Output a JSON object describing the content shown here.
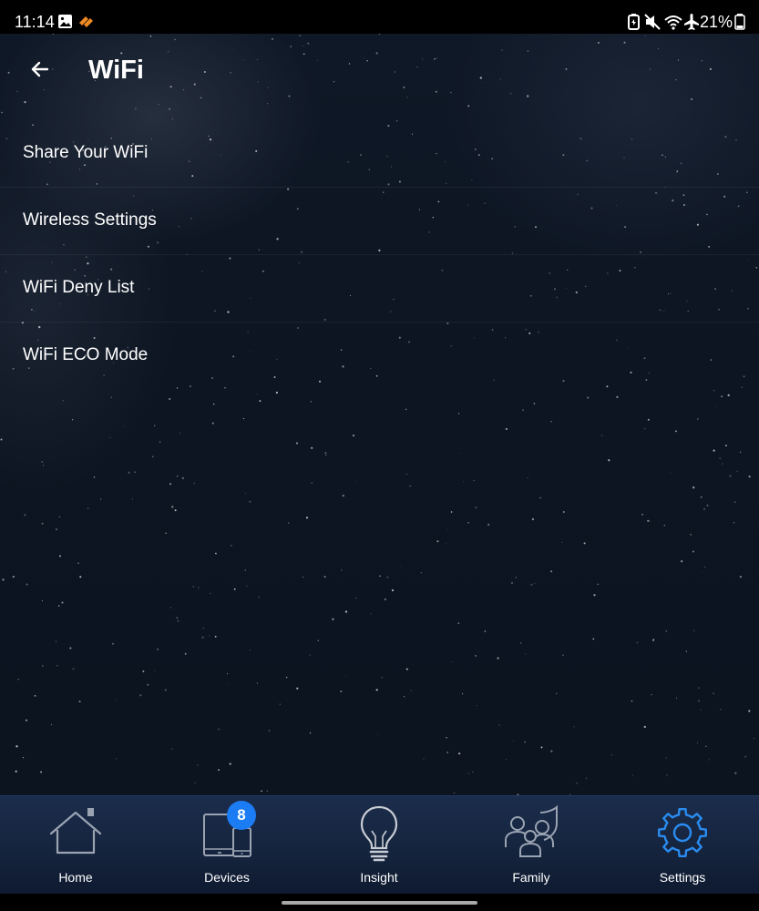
{
  "status_bar": {
    "time": "11:14",
    "battery_percent": "21%",
    "icons": [
      "gallery-icon",
      "app-notification-icon",
      "battery-saver-icon",
      "mute-icon",
      "wifi-icon",
      "airplane-mode-icon",
      "battery-icon"
    ]
  },
  "header": {
    "title": "WiFi",
    "back_icon": "arrow-left-icon"
  },
  "menu": {
    "items": [
      {
        "label": "Share Your WiFi"
      },
      {
        "label": "Wireless Settings"
      },
      {
        "label": "WiFi Deny List"
      },
      {
        "label": "WiFi ECO Mode"
      }
    ]
  },
  "bottom_nav": {
    "items": [
      {
        "label": "Home",
        "icon": "home-icon",
        "active": false
      },
      {
        "label": "Devices",
        "icon": "devices-icon",
        "active": false,
        "badge": "8"
      },
      {
        "label": "Insight",
        "icon": "lightbulb-icon",
        "active": false
      },
      {
        "label": "Family",
        "icon": "family-icon",
        "active": false
      },
      {
        "label": "Settings",
        "icon": "gear-icon",
        "active": true
      }
    ]
  },
  "colors": {
    "accent": "#1c7cf4",
    "active_icon": "#2a8cf0",
    "inactive_icon": "#9aa3b2",
    "text": "#ffffff"
  }
}
